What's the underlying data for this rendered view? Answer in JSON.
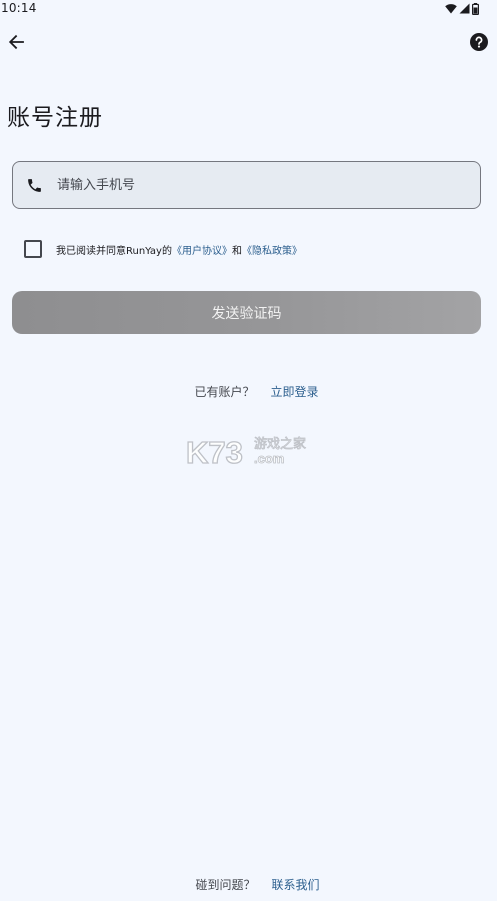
{
  "status_bar": {
    "time": "10:14",
    "icons": [
      "wifi-icon",
      "signal-icon",
      "battery-icon"
    ]
  },
  "top_bar": {
    "back_icon": "arrow-left-icon",
    "help_icon": "help-circle-icon"
  },
  "page": {
    "title": "账号注册"
  },
  "phone": {
    "icon": "phone-icon",
    "value": "",
    "placeholder": "请输入手机号"
  },
  "agreement": {
    "checked": false,
    "prefix": "我已阅读并同意RunYay的",
    "user_agreement": "《用户协议》",
    "conjunction": "和",
    "privacy_policy": "《隐私政策》"
  },
  "send_code": {
    "label": "发送验证码"
  },
  "login": {
    "question": "已有账户？",
    "link": "立即登录"
  },
  "watermark": {
    "logo_text": "K73",
    "sub_text": "游戏之家",
    "domain": ".com"
  },
  "contact": {
    "question": "碰到问题？",
    "link": "联系我们"
  },
  "colors": {
    "background": "#f3f7fe",
    "link": "#2c5f8e",
    "field_background": "#e6ebf2",
    "button_disabled": "#969698"
  }
}
